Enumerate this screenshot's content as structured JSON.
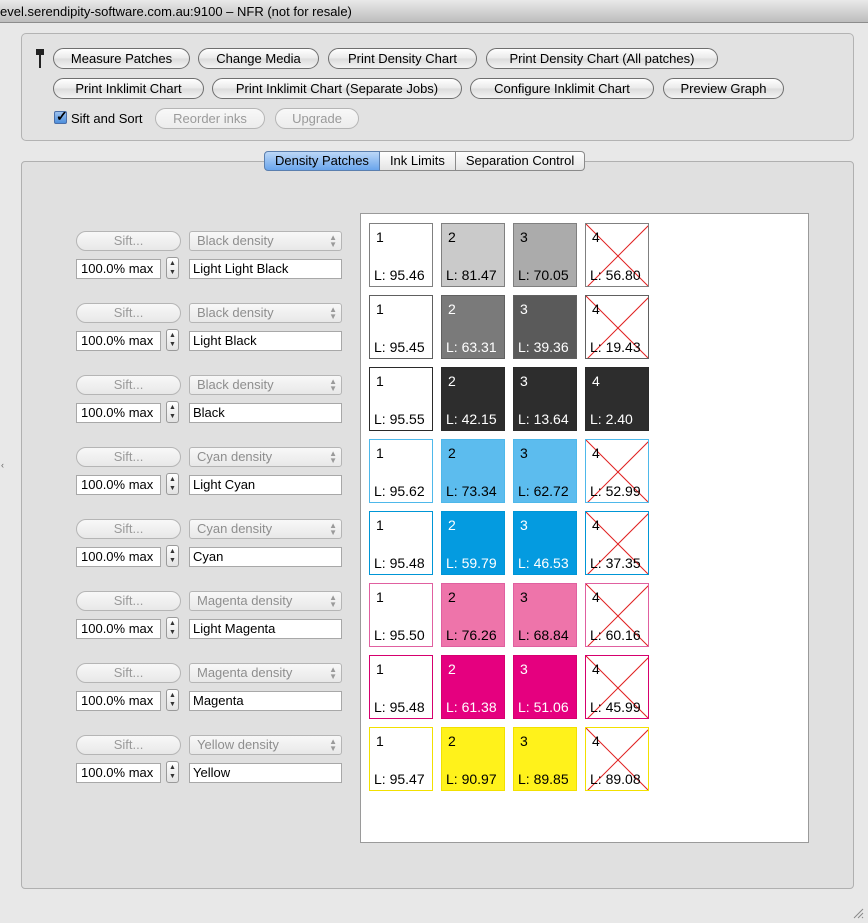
{
  "window": {
    "title": "evel.serendipity-software.com.au:9100 – NFR (not for resale)"
  },
  "toolbar": {
    "row1": [
      "Measure Patches",
      "Change Media",
      "Print Density Chart",
      "Print Density Chart (All patches)"
    ],
    "row2": [
      "Print Inklimit Chart",
      "Print Inklimit Chart (Separate Jobs)",
      "Configure Inklimit Chart",
      "Preview Graph"
    ],
    "sift_and_sort": {
      "label": "Sift and Sort",
      "checked": true
    },
    "reorder_inks": "Reorder inks",
    "upgrade": "Upgrade"
  },
  "tabs": [
    {
      "label": "Density Patches",
      "active": true
    },
    {
      "label": "Ink Limits",
      "active": false
    },
    {
      "label": "Separation Control",
      "active": false
    }
  ],
  "inks": [
    {
      "sift": "Sift...",
      "density": "Black density",
      "max": "100.0% max",
      "name": "Light Light Black",
      "border": "#808080",
      "patches": [
        {
          "n": "1",
          "l": "L: 95.46",
          "bg": "#ffffff",
          "fg": "#000000",
          "crossed": false
        },
        {
          "n": "2",
          "l": "L: 81.47",
          "bg": "#cacaca",
          "fg": "#000000",
          "crossed": false
        },
        {
          "n": "3",
          "l": "L: 70.05",
          "bg": "#ababab",
          "fg": "#000000",
          "crossed": false
        },
        {
          "n": "4",
          "l": "L: 56.80",
          "bg": "#ffffff",
          "fg": "#000000",
          "crossed": true
        }
      ]
    },
    {
      "sift": "Sift...",
      "density": "Black density",
      "max": "100.0% max",
      "name": "Light Black",
      "border": "#606060",
      "patches": [
        {
          "n": "1",
          "l": "L: 95.45",
          "bg": "#ffffff",
          "fg": "#000000",
          "crossed": false
        },
        {
          "n": "2",
          "l": "L: 63.31",
          "bg": "#7a7a7a",
          "fg": "#ffffff",
          "crossed": false
        },
        {
          "n": "3",
          "l": "L: 39.36",
          "bg": "#5a5a5a",
          "fg": "#ffffff",
          "crossed": false
        },
        {
          "n": "4",
          "l": "L: 19.43",
          "bg": "#ffffff",
          "fg": "#000000",
          "crossed": true
        }
      ]
    },
    {
      "sift": "Sift...",
      "density": "Black density",
      "max": "100.0% max",
      "name": "Black",
      "border": "#2a2a2a",
      "patches": [
        {
          "n": "1",
          "l": "L: 95.55",
          "bg": "#ffffff",
          "fg": "#000000",
          "crossed": false
        },
        {
          "n": "2",
          "l": "L: 42.15",
          "bg": "#2d2d2d",
          "fg": "#ffffff",
          "crossed": false
        },
        {
          "n": "3",
          "l": "L: 13.64",
          "bg": "#2d2d2d",
          "fg": "#ffffff",
          "crossed": false
        },
        {
          "n": "4",
          "l": "L: 2.40",
          "bg": "#2d2d2d",
          "fg": "#ffffff",
          "crossed": false
        }
      ]
    },
    {
      "sift": "Sift...",
      "density": "Cyan density",
      "max": "100.0% max",
      "name": "Light Cyan",
      "border": "#4eb8ea",
      "patches": [
        {
          "n": "1",
          "l": "L: 95.62",
          "bg": "#ffffff",
          "fg": "#000000",
          "crossed": false
        },
        {
          "n": "2",
          "l": "L: 73.34",
          "bg": "#5cbcee",
          "fg": "#000000",
          "crossed": false
        },
        {
          "n": "3",
          "l": "L: 62.72",
          "bg": "#5cbcee",
          "fg": "#000000",
          "crossed": false
        },
        {
          "n": "4",
          "l": "L: 52.99",
          "bg": "#ffffff",
          "fg": "#000000",
          "crossed": true
        }
      ]
    },
    {
      "sift": "Sift...",
      "density": "Cyan density",
      "max": "100.0% max",
      "name": "Cyan",
      "border": "#0096d6",
      "patches": [
        {
          "n": "1",
          "l": "L: 95.48",
          "bg": "#ffffff",
          "fg": "#000000",
          "crossed": false
        },
        {
          "n": "2",
          "l": "L: 59.79",
          "bg": "#049be0",
          "fg": "#ffffff",
          "crossed": false
        },
        {
          "n": "3",
          "l": "L: 46.53",
          "bg": "#049be0",
          "fg": "#ffffff",
          "crossed": false
        },
        {
          "n": "4",
          "l": "L: 37.35",
          "bg": "#ffffff",
          "fg": "#000000",
          "crossed": true
        }
      ]
    },
    {
      "sift": "Sift...",
      "density": "Magenta density",
      "max": "100.0% max",
      "name": "Light Magenta",
      "border": "#e060a0",
      "patches": [
        {
          "n": "1",
          "l": "L: 95.50",
          "bg": "#ffffff",
          "fg": "#000000",
          "crossed": false
        },
        {
          "n": "2",
          "l": "L: 76.26",
          "bg": "#ee74aa",
          "fg": "#000000",
          "crossed": false
        },
        {
          "n": "3",
          "l": "L: 68.84",
          "bg": "#ee74aa",
          "fg": "#000000",
          "crossed": false
        },
        {
          "n": "4",
          "l": "L: 60.16",
          "bg": "#ffffff",
          "fg": "#000000",
          "crossed": true
        }
      ]
    },
    {
      "sift": "Sift...",
      "density": "Magenta density",
      "max": "100.0% max",
      "name": "Magenta",
      "border": "#d6006e",
      "patches": [
        {
          "n": "1",
          "l": "L: 95.48",
          "bg": "#ffffff",
          "fg": "#000000",
          "crossed": false
        },
        {
          "n": "2",
          "l": "L: 61.38",
          "bg": "#e5007f",
          "fg": "#ffffff",
          "crossed": false
        },
        {
          "n": "3",
          "l": "L: 51.06",
          "bg": "#e5007f",
          "fg": "#ffffff",
          "crossed": false
        },
        {
          "n": "4",
          "l": "L: 45.99",
          "bg": "#ffffff",
          "fg": "#000000",
          "crossed": true
        }
      ]
    },
    {
      "sift": "Sift...",
      "density": "Yellow density",
      "max": "100.0% max",
      "name": "Yellow",
      "border": "#f2e000",
      "patches": [
        {
          "n": "1",
          "l": "L: 95.47",
          "bg": "#ffffff",
          "fg": "#000000",
          "crossed": false
        },
        {
          "n": "2",
          "l": "L: 90.97",
          "bg": "#fff21b",
          "fg": "#000000",
          "crossed": false
        },
        {
          "n": "3",
          "l": "L: 89.85",
          "bg": "#fff21b",
          "fg": "#000000",
          "crossed": false
        },
        {
          "n": "4",
          "l": "L: 89.08",
          "bg": "#ffffff",
          "fg": "#000000",
          "crossed": true
        }
      ]
    }
  ],
  "colors": {
    "accent": "#6aa5ec",
    "cross": "#e02020"
  },
  "icons": {
    "pin": "pushpin-icon",
    "grip": "resize-grip-icon"
  }
}
